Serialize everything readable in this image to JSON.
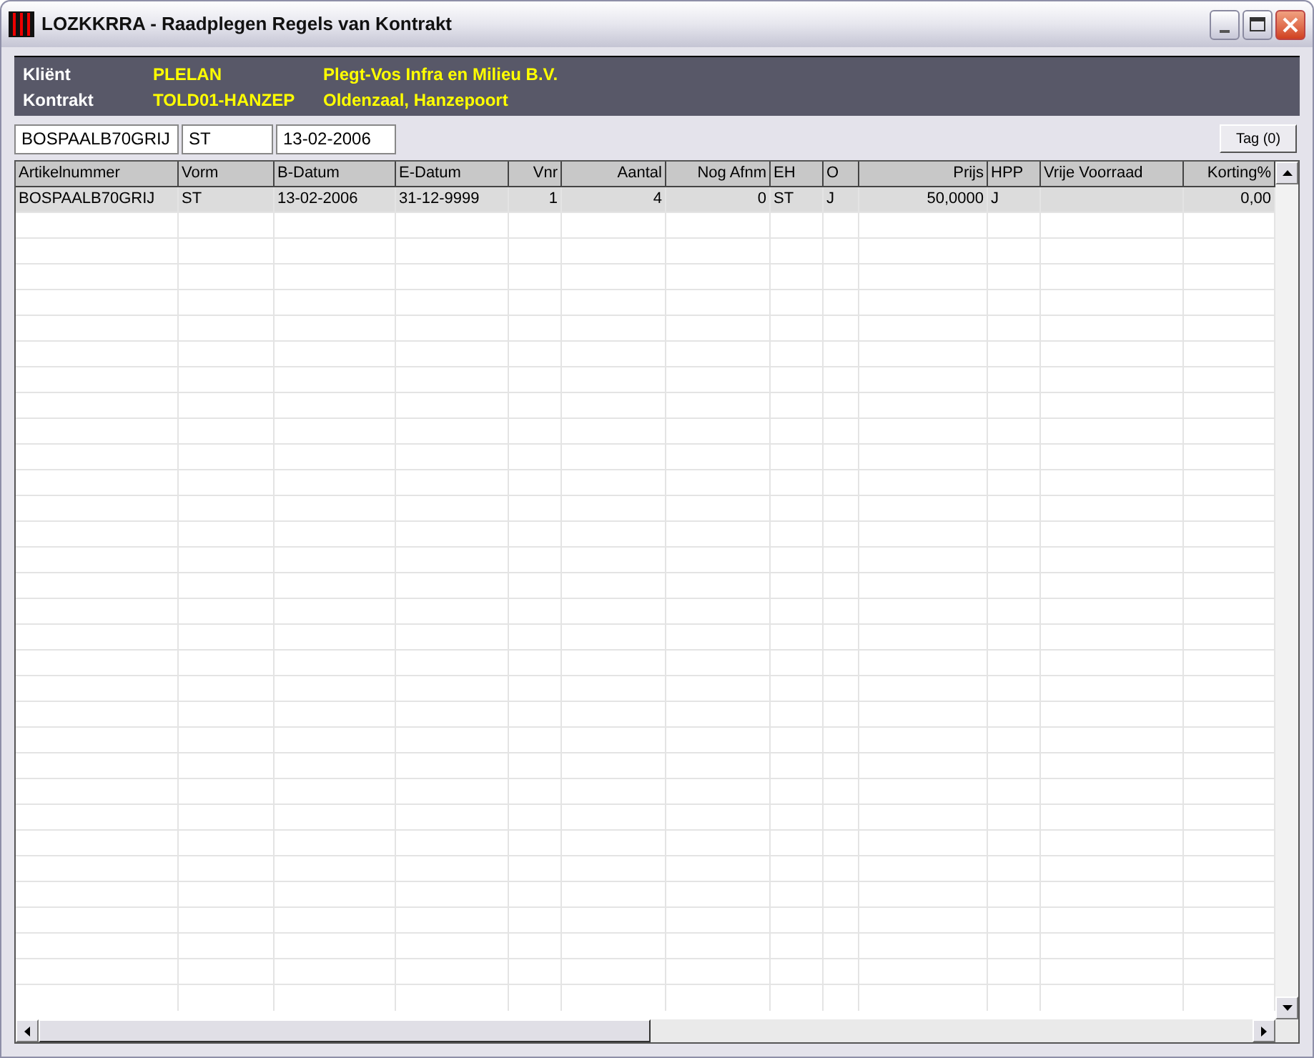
{
  "window": {
    "title": "LOZKKRRA - Raadplegen Regels van Kontrakt"
  },
  "info": [
    {
      "label": "Kliënt",
      "code": "PLELAN",
      "name": "Plegt-Vos Infra en Milieu B.V."
    },
    {
      "label": "Kontrakt",
      "code": "TOLD01-HANZEP",
      "name": "Oldenzaal, Hanzepoort"
    }
  ],
  "filters": [
    {
      "value": "BOSPAALB70GRIJ"
    },
    {
      "value": "ST"
    },
    {
      "value": "13-02-2006"
    }
  ],
  "tag_button": "Tag (0)",
  "table": {
    "columns": [
      {
        "label": "Artikelnummer",
        "kind": "text"
      },
      {
        "label": "Vorm",
        "kind": "text"
      },
      {
        "label": "B-Datum",
        "kind": "text"
      },
      {
        "label": "E-Datum",
        "kind": "text"
      },
      {
        "label": "Vnr",
        "kind": "number"
      },
      {
        "label": "Aantal",
        "kind": "number"
      },
      {
        "label": "Nog Afnm",
        "kind": "number"
      },
      {
        "label": "EH",
        "kind": "text"
      },
      {
        "label": "O",
        "kind": "text"
      },
      {
        "label": "Prijs",
        "kind": "number"
      },
      {
        "label": "HPP",
        "kind": "text"
      },
      {
        "label": "Vrije Voorraad",
        "kind": "text"
      },
      {
        "label": "Korting%",
        "kind": "number"
      }
    ],
    "rows": [
      {
        "selected": true,
        "cells": [
          "BOSPAALB70GRIJ",
          "ST",
          "13-02-2006",
          "31-12-9999",
          "1",
          "4",
          "0",
          "ST",
          "J",
          "50,0000",
          "J",
          "",
          "0,00"
        ]
      }
    ]
  }
}
